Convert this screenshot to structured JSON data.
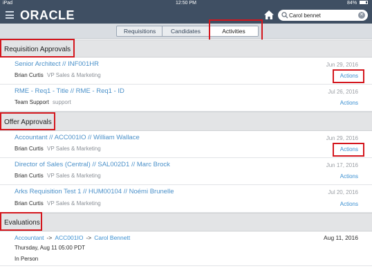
{
  "status_bar": {
    "left": "iPad",
    "time": "12:50 PM",
    "battery": "84%"
  },
  "header": {
    "logo": "ORACLE",
    "search": {
      "value": "Carol bennet",
      "placeholder": "Search"
    }
  },
  "tabs": [
    {
      "label": "Requisitions"
    },
    {
      "label": "Candidates"
    },
    {
      "label": "Activities"
    }
  ],
  "sections": {
    "requisition_approvals": {
      "title": "Requisition Approvals",
      "rows": [
        {
          "title": "Senior Architect // INF001HR",
          "person": "Brian Curtis",
          "dept": "VP Sales & Marketing",
          "date": "Jun 29, 2016",
          "action": "Actions"
        },
        {
          "title": "RME - Req1 - Title // RME - Req1 - ID",
          "person": "Team Support",
          "dept": "support",
          "date": "Jul 26, 2016",
          "action": "Actions"
        }
      ]
    },
    "offer_approvals": {
      "title": "Offer Approvals",
      "rows": [
        {
          "title": "Accountant // ACC001IO // William Wallace",
          "person": "Brian Curtis",
          "dept": "VP Sales & Marketing",
          "date": "Jun 29, 2016",
          "action": "Actions"
        },
        {
          "title": "Director of Sales (Central) // SAL002D1 // Marc Brock",
          "person": "Brian Curtis",
          "dept": "VP Sales & Marketing",
          "date": "Jun 17, 2016",
          "action": "Actions"
        },
        {
          "title": "Arks Requisition Test 1 // HUM00104 // Noémi Brunelle",
          "person": "Brian Curtis",
          "dept": "VP Sales & Marketing",
          "date": "Jul 20, 2016",
          "action": "Actions"
        }
      ]
    },
    "evaluations": {
      "title": "Evaluations",
      "item": {
        "job": "Accountant",
        "arrow1": "->",
        "req": "ACC001IO",
        "arrow2": "->",
        "candidate": "Carol Bennett",
        "date": "Aug 11, 2016",
        "time": "Thursday, Aug 11  05:00 PDT",
        "mode": "In Person"
      }
    }
  },
  "colors": {
    "header": "#3f4f63",
    "link": "#4a90c9",
    "highlight": "#d4161d"
  }
}
